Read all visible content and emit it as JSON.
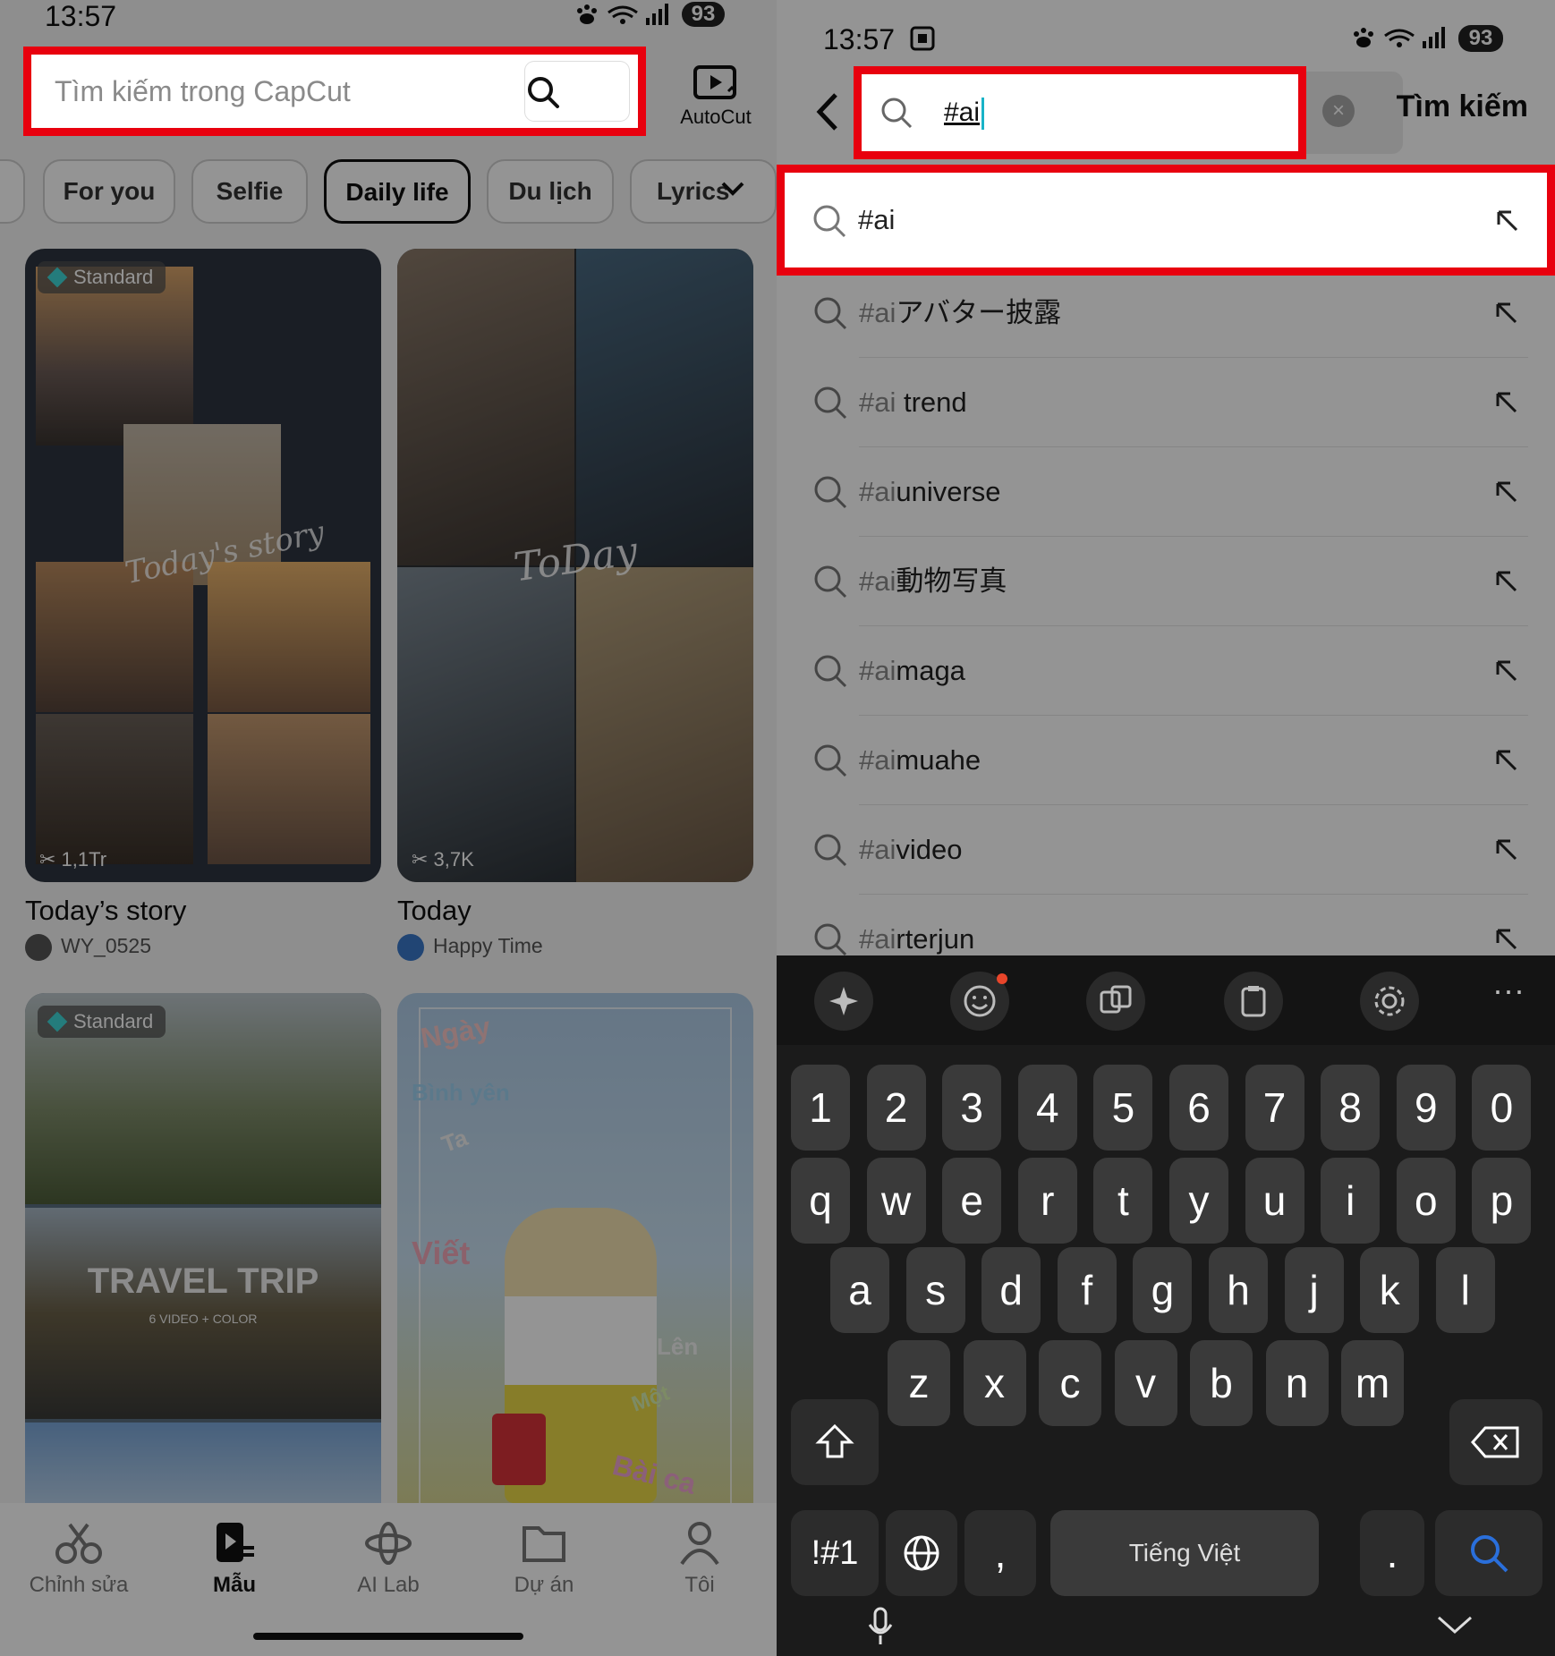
{
  "left": {
    "status": {
      "time": "13:57",
      "battery": "93"
    },
    "search": {
      "placeholder": "Tìm kiếm trong CapCut"
    },
    "autocut_label": "AutoCut",
    "chips": [
      "For you",
      "Selfie",
      "Daily life",
      "Du lịch",
      "Lyrics"
    ],
    "active_chip": "Daily life",
    "cards": [
      {
        "badge": "Standard",
        "uses": "1,1Tr",
        "title": "Today’s story",
        "author": "WY_0525",
        "overlay": "Today's story"
      },
      {
        "badge": "",
        "uses": "3,7K",
        "title": "Today",
        "author": "Happy Time",
        "overlay": "ToDay"
      },
      {
        "badge": "Standard",
        "overlay": "TRAVEL TRIP",
        "overlay_sub": "6 VIDEO + COLOR"
      },
      {
        "badge": "",
        "overlay_words": [
          "Ngày",
          "Bình yên",
          "Ta",
          "Viết",
          "Lên",
          "Một",
          "Bài ca"
        ]
      }
    ],
    "nav": [
      {
        "label": "Chỉnh sửa",
        "icon": "scissors-icon"
      },
      {
        "label": "Mẫu",
        "icon": "template-icon"
      },
      {
        "label": "AI Lab",
        "icon": "ai-lab-icon"
      },
      {
        "label": "Dự án",
        "icon": "folder-icon"
      },
      {
        "label": "Tôi",
        "icon": "user-icon"
      }
    ],
    "active_nav": "Mẫu"
  },
  "right": {
    "status": {
      "time": "13:57",
      "battery": "93"
    },
    "search": {
      "query": "#ai"
    },
    "search_button": "Tìm kiếm",
    "suggestions": [
      {
        "prefix": "#ai",
        "suffix": ""
      },
      {
        "prefix": "#ai",
        "suffix": "アバター披露"
      },
      {
        "prefix": "#ai",
        "suffix": " trend"
      },
      {
        "prefix": "#ai",
        "suffix": "universe"
      },
      {
        "prefix": "#ai",
        "suffix": "動物写真"
      },
      {
        "prefix": "#ai",
        "suffix": "maga"
      },
      {
        "prefix": "#ai",
        "suffix": "muahe"
      },
      {
        "prefix": "#ai",
        "suffix": "video"
      },
      {
        "prefix": "#ai",
        "suffix": "rterjun"
      }
    ],
    "keyboard": {
      "row_numbers": [
        "1",
        "2",
        "3",
        "4",
        "5",
        "6",
        "7",
        "8",
        "9",
        "0"
      ],
      "row1": [
        "q",
        "w",
        "e",
        "r",
        "t",
        "y",
        "u",
        "i",
        "o",
        "p"
      ],
      "row2": [
        "a",
        "s",
        "d",
        "f",
        "g",
        "h",
        "j",
        "k",
        "l"
      ],
      "row3": [
        "z",
        "x",
        "c",
        "v",
        "b",
        "n",
        "m"
      ],
      "symbols_key": "!#1",
      "comma": ",",
      "space_label": "Tiếng Việt",
      "period": "."
    }
  },
  "colors": {
    "highlight": "#e8000e",
    "cursor": "#19b3c7",
    "search_key": "#2a6fdb"
  }
}
